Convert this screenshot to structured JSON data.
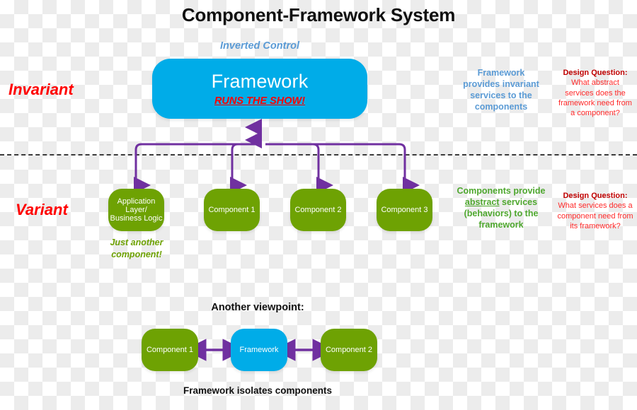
{
  "title": "Component-Framework System",
  "inverted_control_caption": "Inverted Control",
  "framework_box": {
    "name": "Framework",
    "subtitle": "RUNS THE SHOW!"
  },
  "side_labels": {
    "invariant": "Invariant",
    "variant": "Variant"
  },
  "components_row": [
    {
      "line1": "Application",
      "line2": "Layer/",
      "line3": "Business Logic"
    },
    {
      "line1": "Component 1"
    },
    {
      "line1": "Component 2"
    },
    {
      "line1": "Component 3"
    }
  ],
  "just_another_component": "Just another component!",
  "notes": {
    "framework_services": "Framework provides invariant services to the components",
    "components_services_pre": "Components provide ",
    "components_services_underlined": "abstract",
    "components_services_post": " services (behaviors) to the framework"
  },
  "design_questions": [
    {
      "heading": "Design Question:",
      "body": "What abstract services does the framework need from a component?"
    },
    {
      "heading": "Design Question:",
      "body": "What services does a component need from its framework?"
    }
  ],
  "bottom": {
    "heading": "Another viewpoint:",
    "left_component": "Component 1",
    "center_framework": "Framework",
    "right_component": "Component 2",
    "caption": "Framework isolates components"
  },
  "colors": {
    "framework_blue": "#00ace8",
    "component_green": "#6ea203",
    "arrow_purple": "#7030a0",
    "invariant_red": "#ff0000",
    "caption_blue": "#5b9bd5",
    "note_green": "#4ea72e",
    "design_question_red": "#ff2a2a",
    "divider": "#3b3b3b"
  }
}
